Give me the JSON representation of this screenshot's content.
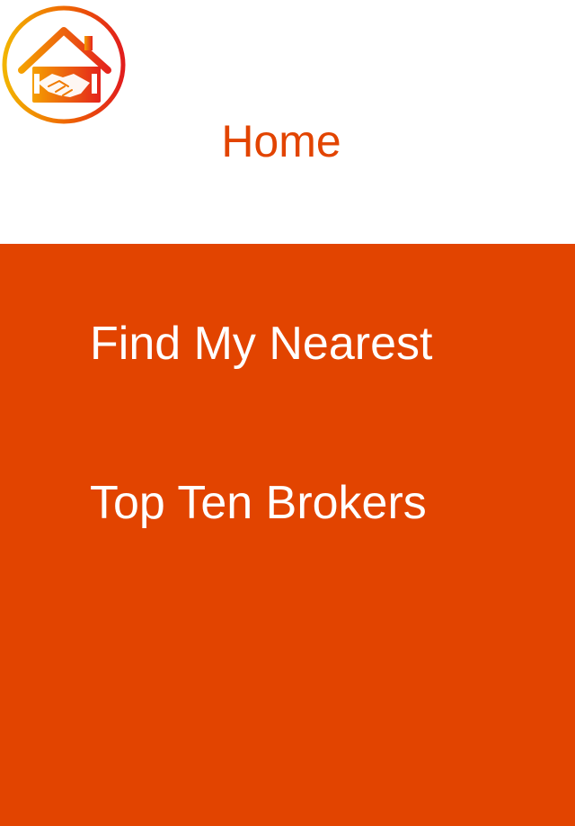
{
  "colors": {
    "accent": "#e24400",
    "background": "#ffffff",
    "menu_text": "#ffffff"
  },
  "header": {
    "logo_icon": "house-handshake-icon",
    "title": "Home"
  },
  "menu": {
    "items": [
      {
        "label": "Find My Nearest"
      },
      {
        "label": "Top Ten Brokers"
      }
    ]
  }
}
